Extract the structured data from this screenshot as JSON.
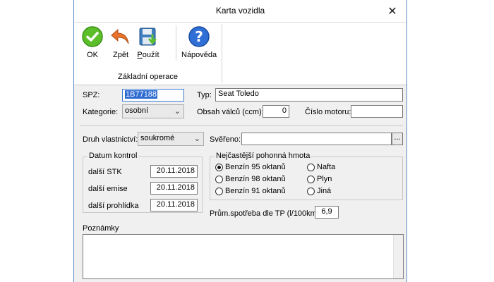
{
  "window": {
    "title": "Karta vozidla"
  },
  "ribbon": {
    "buttons": [
      {
        "label": "OK",
        "icon": "ok-check-icon"
      },
      {
        "label": "Zpět",
        "icon": "back-arrow-icon"
      },
      {
        "label": "Použít",
        "icon": "save-disk-icon"
      },
      {
        "label": "Nápověda",
        "icon": "help-question-icon"
      }
    ],
    "group_label": "Základní operace"
  },
  "form": {
    "spz_label": "SPZ:",
    "spz_value": "1B77188",
    "typ_label": "Typ:",
    "typ_value": "Seat Toledo",
    "kategorie_label": "Kategorie:",
    "kategorie_value": "osobní",
    "obsah_label": "Obsah válců (ccm):",
    "obsah_value": "0",
    "cislo_label": "Číslo motoru:",
    "cislo_value": "",
    "druh_label": "Druh vlastnictví:",
    "druh_value": "soukromé",
    "svereno_label": "Svěřeno:",
    "svereno_value": "",
    "svereno_btn": "..."
  },
  "kontroly": {
    "title": "Datum kontrol",
    "rows": [
      {
        "label": "další STK",
        "value": "20.11.2018"
      },
      {
        "label": "další emise",
        "value": "20.11.2018"
      },
      {
        "label": "další prohlídka",
        "value": "20.11.2018"
      }
    ]
  },
  "palivo": {
    "title": "Nejčastější pohonná hmota",
    "options": [
      {
        "label": "Benzín 95 oktanů",
        "selected": true
      },
      {
        "label": "Benzín 98 oktanů",
        "selected": false
      },
      {
        "label": "Benzín 91 oktanů",
        "selected": false
      },
      {
        "label": "Nafta",
        "selected": false
      },
      {
        "label": "Plyn",
        "selected": false
      },
      {
        "label": "Jiná",
        "selected": false
      }
    ],
    "spotreba_label": "Prům.spotřeba dle TP (l/100km):",
    "spotreba_value": "6,9"
  },
  "notes": {
    "label": "Poznámky",
    "value": ""
  },
  "colors": {
    "accent": "#1a5fb4",
    "ok_green": "#4caf1e",
    "back_orange": "#e06a1a",
    "help_blue": "#2a6fd6"
  }
}
